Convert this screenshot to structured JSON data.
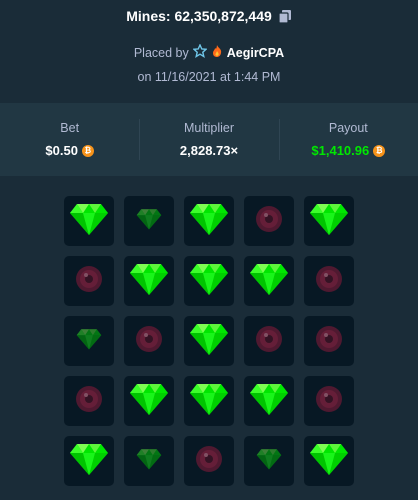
{
  "header": {
    "title": "Mines: 62,350,872,449",
    "placed_by_label": "Placed by",
    "username": "AegirCPA",
    "date": "on 11/16/2021 at 1:44 PM"
  },
  "icons": {
    "copy": "copy-icon",
    "vip": "star-badge-icon",
    "streak": "flame-icon",
    "currency": "bitcoin-icon"
  },
  "stats": {
    "bet": {
      "label": "Bet",
      "value": "$0.50"
    },
    "multiplier": {
      "label": "Multiplier",
      "value": "2,828.73×"
    },
    "payout": {
      "label": "Payout",
      "value": "$1,410.96"
    }
  },
  "colors": {
    "background": "#1a2c38",
    "panel": "#213743",
    "tile": "#071824",
    "gem": "#00e701",
    "mine": "#8a1a3a",
    "payout": "#00e701",
    "bitcoin": "#f7931a"
  },
  "grid": {
    "rows": [
      [
        "gem",
        "gem-dim",
        "gem",
        "mine",
        "gem"
      ],
      [
        "mine",
        "gem",
        "gem",
        "gem",
        "mine"
      ],
      [
        "gem-dim",
        "mine",
        "gem",
        "mine",
        "mine"
      ],
      [
        "mine",
        "gem",
        "gem",
        "gem",
        "mine"
      ],
      [
        "gem",
        "gem-dim",
        "mine",
        "gem-dim",
        "gem"
      ]
    ]
  }
}
